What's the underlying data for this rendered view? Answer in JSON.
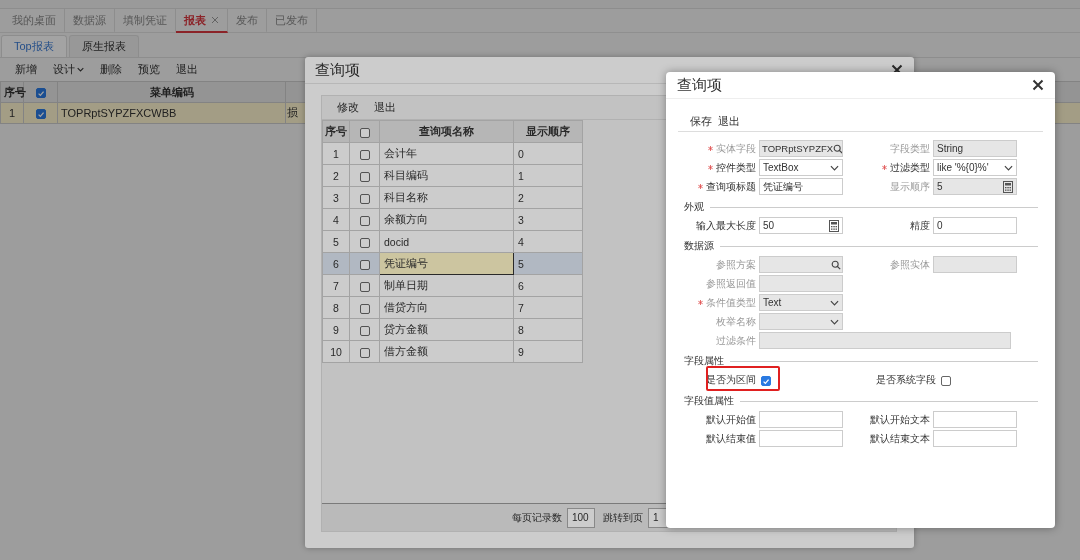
{
  "main_tabs": [
    {
      "label": "我的桌面",
      "selected": false
    },
    {
      "label": "数据源",
      "selected": false
    },
    {
      "label": "填制凭证",
      "selected": false
    },
    {
      "label": "报表",
      "selected": true
    },
    {
      "label": "发布",
      "selected": false
    },
    {
      "label": "已发布",
      "selected": false
    }
  ],
  "sub_tabs": [
    {
      "label": "Top报表",
      "selected": true
    },
    {
      "label": "原生报表",
      "selected": false
    }
  ],
  "toolbar": [
    {
      "label": "新增",
      "dropdown": false
    },
    {
      "label": "设计",
      "dropdown": true
    },
    {
      "label": "删除",
      "dropdown": false
    },
    {
      "label": "预览",
      "dropdown": false
    },
    {
      "label": "退出",
      "dropdown": false
    }
  ],
  "table": {
    "index_header": "序号",
    "all_checked": true,
    "code_header": "菜单编码",
    "rows": [
      {
        "index": "1",
        "checked": true,
        "code": "TOPRptSYPZFXCWBB",
        "column_4": "损",
        "selected": true
      }
    ]
  },
  "query_dialog": {
    "title": "查询项",
    "toolbar": [
      "修改",
      "退出"
    ],
    "columns": {
      "index": "序号",
      "all_checked": false,
      "name": "查询项名称",
      "order": "显示顺序"
    },
    "rows": [
      {
        "index": "1",
        "checked": false,
        "name": "会计年",
        "order": "0",
        "selected": false
      },
      {
        "index": "2",
        "checked": false,
        "name": "科目编码",
        "order": "1",
        "selected": false
      },
      {
        "index": "3",
        "checked": false,
        "name": "科目名称",
        "order": "2",
        "selected": false
      },
      {
        "index": "4",
        "checked": false,
        "name": "余额方向",
        "order": "3",
        "selected": false
      },
      {
        "index": "5",
        "checked": false,
        "name": "docid",
        "order": "4",
        "selected": false
      },
      {
        "index": "6",
        "checked": false,
        "name": "凭证编号",
        "order": "5",
        "selected": true
      },
      {
        "index": "7",
        "checked": false,
        "name": "制单日期",
        "order": "6",
        "selected": false
      },
      {
        "index": "8",
        "checked": false,
        "name": "借贷方向",
        "order": "7",
        "selected": false
      },
      {
        "index": "9",
        "checked": false,
        "name": "贷方金额",
        "order": "8",
        "selected": false
      },
      {
        "index": "10",
        "checked": false,
        "name": "借方金额",
        "order": "9",
        "selected": false
      }
    ],
    "pager": {
      "page_size_label": "每页记录数",
      "page_size": "100",
      "jump_label": "跳转到页",
      "page": "1"
    }
  },
  "editor_dialog": {
    "title": "查询项",
    "toolbar": [
      "保存",
      "退出"
    ],
    "sections": [
      {
        "rows": [
          {
            "fields": [
              {
                "label": "实体字段",
                "required": true,
                "disabled": true,
                "kind": "search",
                "value": "TOPRptSYPZFX"
              },
              {
                "label": "字段类型",
                "required": false,
                "disabled": true,
                "kind": "text",
                "value": "String"
              }
            ]
          },
          {
            "fields": [
              {
                "label": "控件类型",
                "required": true,
                "disabled": false,
                "kind": "select",
                "value": "TextBox"
              },
              {
                "label": "过滤类型",
                "required": true,
                "disabled": false,
                "kind": "select",
                "value": "like '%{0}%'"
              }
            ]
          },
          {
            "fields": [
              {
                "label": "查询项标题",
                "required": true,
                "disabled": false,
                "kind": "text",
                "value": "凭证编号"
              },
              {
                "label": "显示顺序",
                "required": false,
                "disabled": true,
                "kind": "number",
                "value": "5"
              }
            ]
          }
        ]
      },
      {
        "title": "外观",
        "rows": [
          {
            "fields": [
              {
                "label": "输入最大长度",
                "required": false,
                "disabled": false,
                "kind": "number",
                "value": "50"
              },
              {
                "label": "精度",
                "required": false,
                "disabled": false,
                "kind": "text",
                "value": "0"
              }
            ]
          }
        ]
      },
      {
        "title": "数据源",
        "rows": [
          {
            "fields": [
              {
                "label": "参照方案",
                "required": false,
                "disabled": true,
                "kind": "search"
              },
              {
                "label": "参照实体",
                "required": false,
                "disabled": true,
                "kind": "text"
              }
            ]
          },
          {
            "fields": [
              {
                "label": "参照返回值",
                "required": false,
                "disabled": true,
                "kind": "text"
              }
            ]
          },
          {
            "fields": [
              {
                "label": "条件值类型",
                "required": true,
                "disabled": true,
                "kind": "select",
                "value": "Text"
              }
            ]
          },
          {
            "fields": [
              {
                "label": "枚举名称",
                "required": false,
                "disabled": true,
                "kind": "select"
              }
            ]
          },
          {
            "fields": [
              {
                "label": "过滤条件",
                "required": false,
                "disabled": true,
                "kind": "wide"
              }
            ]
          }
        ]
      },
      {
        "title": "字段属性",
        "rows": [
          {
            "fields": [
              {
                "label": "是否为区间",
                "required": false,
                "disabled": false,
                "kind": "checkbox",
                "checked": true,
                "highlighted": true
              },
              {
                "label": "是否系统字段",
                "required": false,
                "disabled": false,
                "kind": "checkbox",
                "checked": false,
                "highlighted": false
              }
            ]
          }
        ]
      },
      {
        "title": "字段值属性",
        "rows": [
          {
            "fields": [
              {
                "label": "默认开始值",
                "required": false,
                "disabled": false,
                "kind": "text"
              },
              {
                "label": "默认开始文本",
                "required": false,
                "disabled": false,
                "kind": "text"
              }
            ]
          },
          {
            "fields": [
              {
                "label": "默认结束值",
                "required": false,
                "disabled": false,
                "kind": "text"
              },
              {
                "label": "默认结束文本",
                "required": false,
                "disabled": false,
                "kind": "text"
              }
            ]
          }
        ]
      }
    ]
  }
}
